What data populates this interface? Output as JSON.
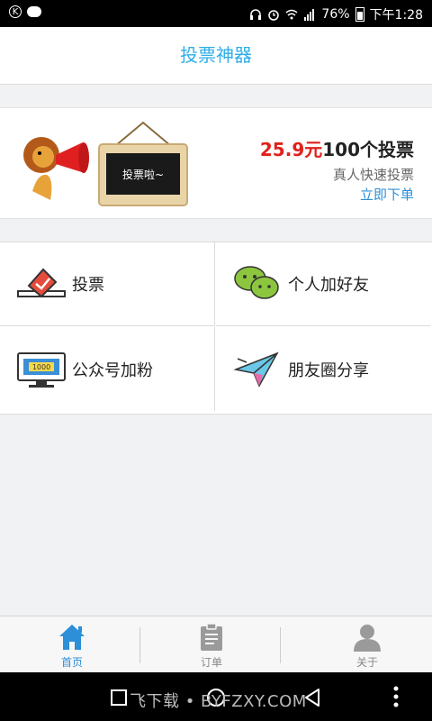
{
  "status_bar": {
    "battery": "76%",
    "time": "下午1:28",
    "icons": [
      "k-icon",
      "chat-icon",
      "headset-icon",
      "alarm-icon",
      "wifi-icon",
      "signal-icon",
      "battery-icon"
    ]
  },
  "header": {
    "title": "投票神器"
  },
  "banner": {
    "price": "25.9元",
    "offer": "100个投票",
    "description": "真人快速投票",
    "order_link": "立即下单",
    "board_text": "投票啦~"
  },
  "features": [
    {
      "label": "投票",
      "icon": "ballot-box-icon"
    },
    {
      "label": "个人加好友",
      "icon": "wechat-icon"
    },
    {
      "label": "公众号加粉",
      "icon": "monitor-icon",
      "badge": "1000"
    },
    {
      "label": "朋友圈分享",
      "icon": "paper-plane-icon"
    }
  ],
  "tabs": [
    {
      "label": "首页",
      "icon": "home-icon",
      "active": true
    },
    {
      "label": "订单",
      "icon": "clipboard-icon",
      "active": false
    },
    {
      "label": "关于",
      "icon": "user-icon",
      "active": false
    }
  ],
  "watermark": "飞下载 • BYFZXY.COM",
  "colors": {
    "accent": "#2eaee8",
    "price_red": "#e0201a",
    "link_blue": "#2c8fd8"
  }
}
